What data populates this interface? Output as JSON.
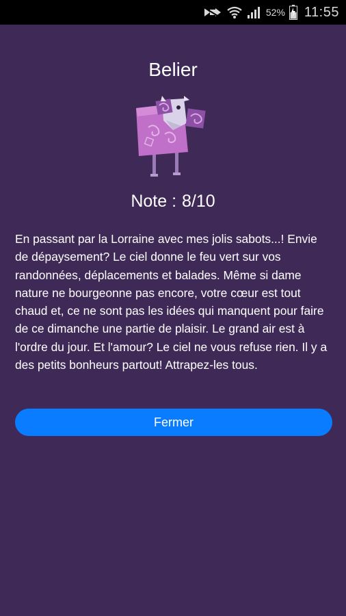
{
  "status_bar": {
    "battery_percent": "52%",
    "time": "11:55",
    "icons": [
      "notification-mute-icon",
      "wifi-icon",
      "signal-icon",
      "battery-icon"
    ]
  },
  "horoscope": {
    "sign": "Belier",
    "note_label": "Note :",
    "note_value": "8/10",
    "text": "En passant par la Lorraine avec mes jolis sabots...! Envie de dépaysement? Le ciel donne le feu vert sur vos randonnées, déplacements et balades. Même si dame nature ne bourgeonne pas encore, votre cœur est tout chaud et, ce ne sont pas les idées qui manquent pour faire de ce dimanche une partie de plaisir. Le grand air est à l'ordre du jour. Et l'amour? Le ciel ne vous refuse rien. Il y a des petits bonheurs partout! Attrapez-les tous."
  },
  "actions": {
    "close_label": "Fermer"
  },
  "colors": {
    "background": "#3f2a57",
    "button": "#0a7cff",
    "mascot_body": "#c070c8",
    "mascot_horn": "#8e4fa6"
  }
}
